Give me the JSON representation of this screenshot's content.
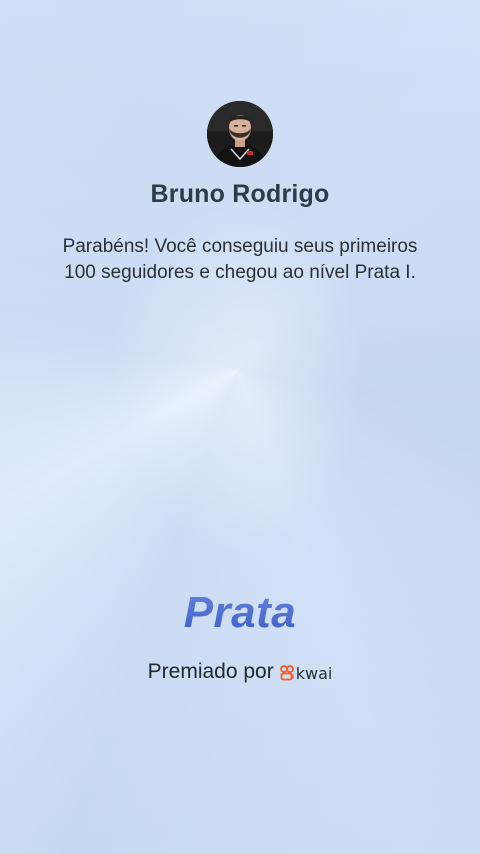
{
  "profile": {
    "name": "Bruno Rodrigo",
    "avatar_icon": "user-avatar"
  },
  "message": {
    "text": "Parabéns! Você conseguiu seus primeiros 100 seguidores e chegou ao nível Prata I."
  },
  "badge": {
    "title": "Prata"
  },
  "award": {
    "label": "Premiado por",
    "brand": "kwai",
    "brand_icon": "kwai-logo-icon",
    "brand_color": "#ff5a1f"
  },
  "colors": {
    "badge_title": "#4f6fd0",
    "name_text": "#2f3a4b",
    "body_text": "#2b2f38",
    "background": "#c9dcf2"
  }
}
